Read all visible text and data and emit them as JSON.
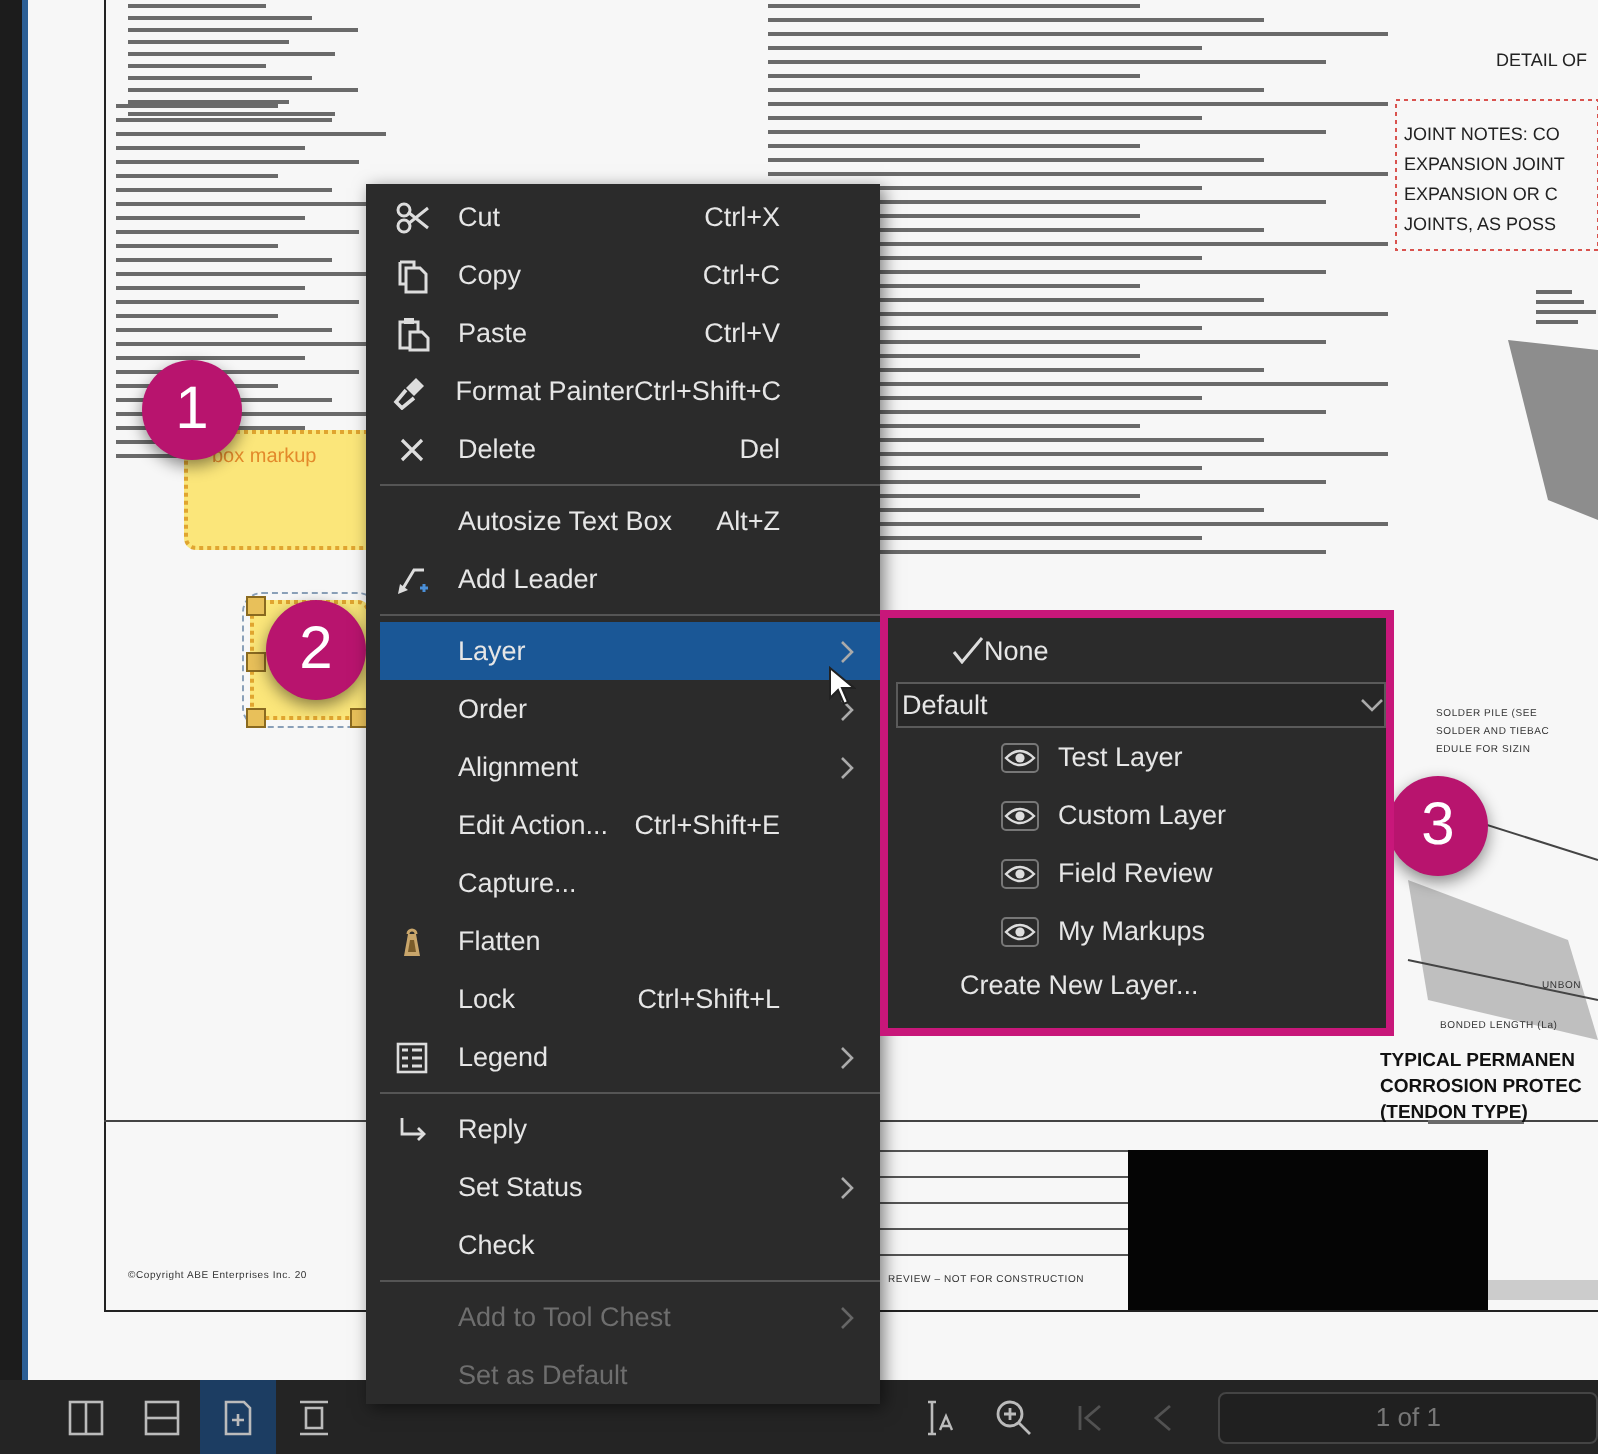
{
  "document": {
    "detail_title": "DETAIL OF",
    "joint_notes": [
      "JOINT NOTES: CO",
      "EXPANSION JOINT",
      "EXPANSION OR C",
      "JOINTS, AS POSS"
    ],
    "pile_notes": [
      "SOLDER PILE (SEE",
      "SOLDER AND TIEBAC",
      "EDULE FOR SIZIN"
    ],
    "bonded_length": "BONDED LENGTH (La)",
    "unbonded": "UNBON",
    "section_title": [
      "TYPICAL PERMANEN",
      "CORROSION PROTEC",
      "(TENDON TYPE)"
    ],
    "copyright": "©Copyright ABE Enterprises Inc. 20",
    "review_stamp": "REVIEW – NOT FOR CONSTRUCTION"
  },
  "markups": [
    {
      "text": "box markup",
      "selected": false
    },
    {
      "selected": true
    }
  ],
  "callouts": [
    {
      "number": "1"
    },
    {
      "number": "2"
    },
    {
      "number": "3"
    }
  ],
  "context_menu": {
    "groups": [
      [
        {
          "label": "Cut",
          "shortcut": "Ctrl+X",
          "submenu": false,
          "selected": false,
          "disabled": false
        },
        {
          "label": "Copy",
          "shortcut": "Ctrl+C",
          "submenu": false,
          "selected": false,
          "disabled": false
        },
        {
          "label": "Paste",
          "shortcut": "Ctrl+V",
          "submenu": false,
          "selected": false,
          "disabled": false
        },
        {
          "label": "Format Painter",
          "shortcut": "Ctrl+Shift+C",
          "submenu": false,
          "selected": false,
          "disabled": false
        },
        {
          "label": "Delete",
          "shortcut": "Del",
          "submenu": false,
          "selected": false,
          "disabled": false
        }
      ],
      [
        {
          "label": "Autosize Text Box",
          "shortcut": "Alt+Z",
          "submenu": false,
          "selected": false,
          "disabled": false
        },
        {
          "label": "Add Leader",
          "submenu": false,
          "selected": false,
          "disabled": false
        }
      ],
      [
        {
          "label": "Layer",
          "submenu": true,
          "selected": true,
          "disabled": false
        },
        {
          "label": "Order",
          "submenu": true,
          "selected": false,
          "disabled": false
        },
        {
          "label": "Alignment",
          "submenu": true,
          "selected": false,
          "disabled": false
        },
        {
          "label": "Edit Action...",
          "shortcut": "Ctrl+Shift+E",
          "submenu": false,
          "selected": false,
          "disabled": false
        },
        {
          "label": "Capture...",
          "submenu": false,
          "selected": false,
          "disabled": false
        },
        {
          "label": "Flatten",
          "submenu": false,
          "selected": false,
          "disabled": false
        },
        {
          "label": "Lock",
          "shortcut": "Ctrl+Shift+L",
          "submenu": false,
          "selected": false,
          "disabled": false
        },
        {
          "label": "Legend",
          "submenu": true,
          "selected": false,
          "disabled": false
        }
      ],
      [
        {
          "label": "Reply",
          "submenu": false,
          "selected": false,
          "disabled": false
        },
        {
          "label": "Set Status",
          "submenu": true,
          "selected": false,
          "disabled": false
        },
        {
          "label": "Check",
          "submenu": false,
          "selected": false,
          "disabled": false
        }
      ],
      [
        {
          "label": "Add to Tool Chest",
          "submenu": true,
          "selected": false,
          "disabled": true
        },
        {
          "label": "Set as Default",
          "submenu": false,
          "selected": false,
          "disabled": true
        }
      ]
    ]
  },
  "layer_submenu": {
    "none": {
      "label": "None",
      "checked": true
    },
    "layer_set": {
      "value": "Default"
    },
    "layers": [
      {
        "label": "Test Layer",
        "visible": true
      },
      {
        "label": "Custom Layer",
        "visible": true
      },
      {
        "label": "Field Review",
        "visible": true
      },
      {
        "label": "My Markups",
        "visible": true
      }
    ],
    "create": "Create New Layer..."
  },
  "toolbar": {
    "left_buttons": [
      {
        "selected": false
      },
      {
        "selected": false
      },
      {
        "selected": true
      },
      {
        "selected": false
      }
    ],
    "right_buttons": [
      {
        "disabled": false
      },
      {
        "disabled": false
      },
      {
        "disabled": true
      },
      {
        "disabled": true
      }
    ],
    "page_field": {
      "value": "1 of 1"
    }
  }
}
